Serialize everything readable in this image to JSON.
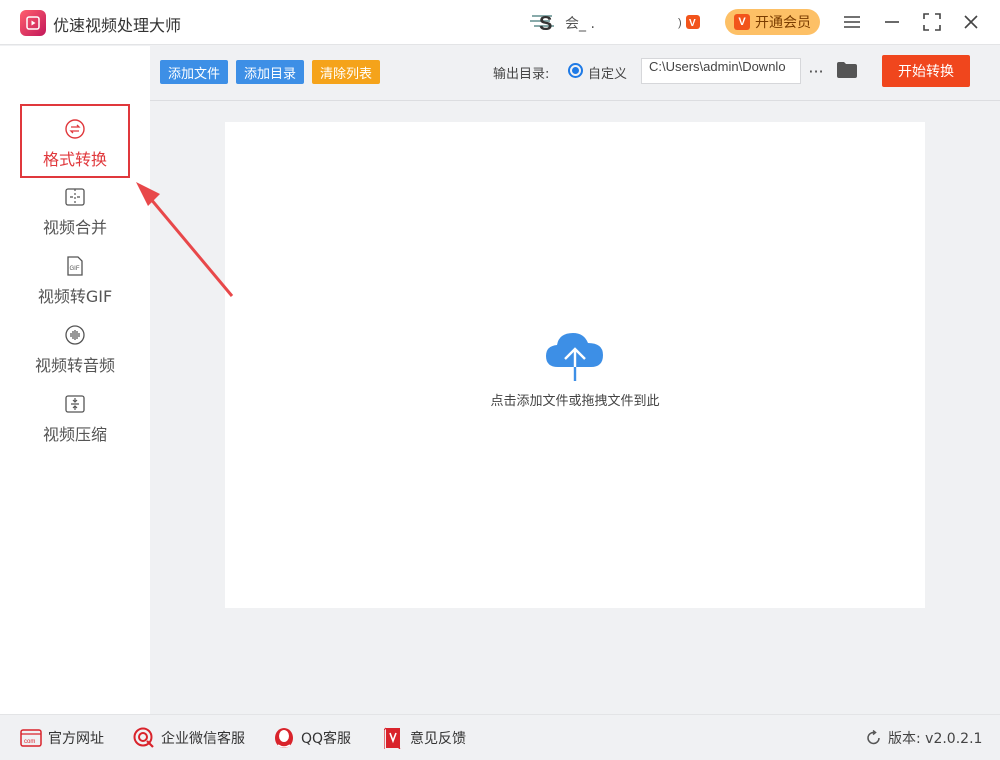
{
  "app": {
    "title": "优速视频处理大师"
  },
  "user": {
    "name": "会_ ."
  },
  "header": {
    "vip_label": "开通会员"
  },
  "sidebar": {
    "items": [
      {
        "label": "格式转换",
        "icon": "format-convert-icon",
        "active": true
      },
      {
        "label": "视频合并",
        "icon": "video-merge-icon",
        "active": false
      },
      {
        "label": "视频转GIF",
        "icon": "gif-icon",
        "active": false
      },
      {
        "label": "视频转音频",
        "icon": "audio-icon",
        "active": false
      },
      {
        "label": "视频压缩",
        "icon": "compress-icon",
        "active": false
      }
    ]
  },
  "toolbar": {
    "add_file": "添加文件",
    "add_dir": "添加目录",
    "clear_list": "清除列表",
    "output_label": "输出目录:",
    "custom_label": "自定义",
    "output_path": "C:\\Users\\admin\\Downlo",
    "more": "···",
    "start": "开始转换"
  },
  "dropzone": {
    "hint": "点击添加文件或拖拽文件到此"
  },
  "footer": {
    "website": "官方网址",
    "wechat": "企业微信客服",
    "qq": "QQ客服",
    "feedback": "意见反馈",
    "version": "版本: v2.0.2.1"
  },
  "colors": {
    "accent_red": "#e0383c",
    "button_blue": "#3d8fe6",
    "button_orange": "#f5a31a",
    "start_red": "#f0461d",
    "vip_gold": "#fdc066",
    "cloud_blue": "#3d8fe6"
  }
}
